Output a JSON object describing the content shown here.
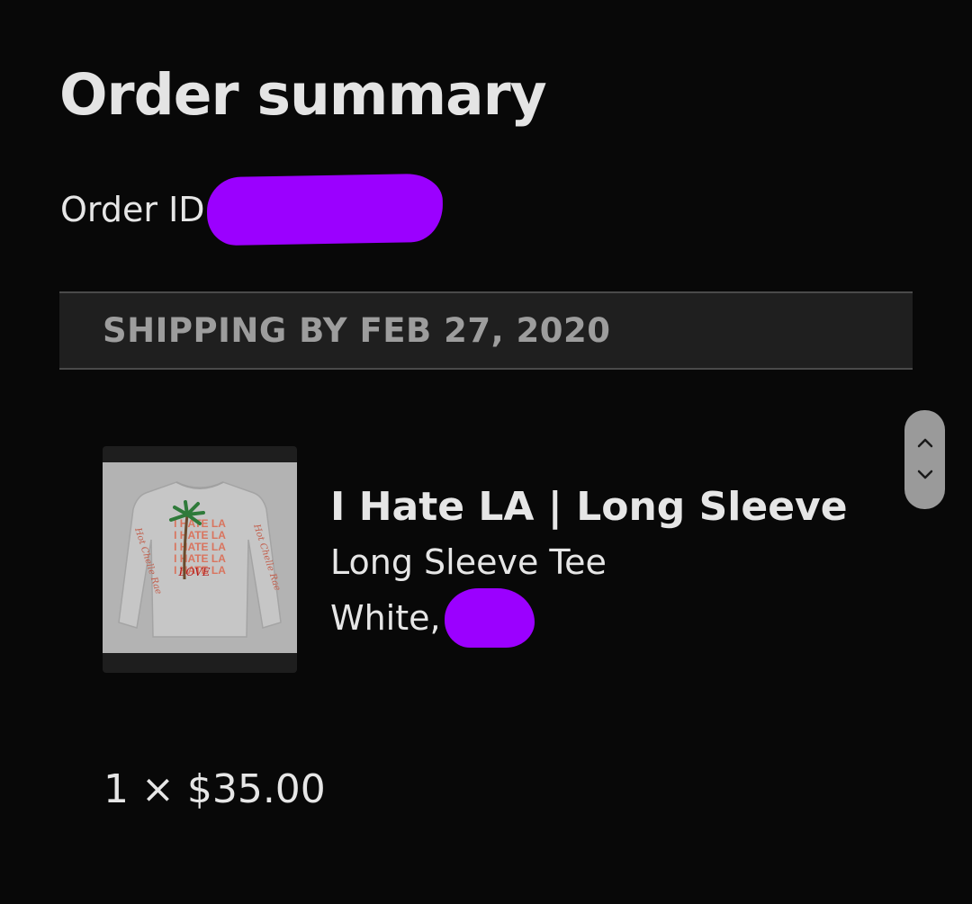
{
  "header": {
    "title": "Order summary",
    "order_id_label": "Order ID"
  },
  "shipping": {
    "text": "SHIPPING BY FEB 27, 2020"
  },
  "product": {
    "name": "I Hate LA | Long Sleeve",
    "type": "Long Sleeve Tee",
    "variant_label": "White,",
    "image_text": {
      "repeat_line": "I HATE LA",
      "overlay": "LOVE",
      "sleeve_left": "Hot Chelle Rae",
      "sleeve_right": "Hot Chelle Rae"
    }
  },
  "quantity_price": "1 × $35.00",
  "scroll": {
    "up_icon": "chevron-up-icon",
    "down_icon": "chevron-down-icon"
  },
  "colors": {
    "background": "#080808",
    "redaction": "#9b00ff",
    "shipping_bar": "#1f1f1f",
    "shipping_text": "#9d9d9d"
  }
}
